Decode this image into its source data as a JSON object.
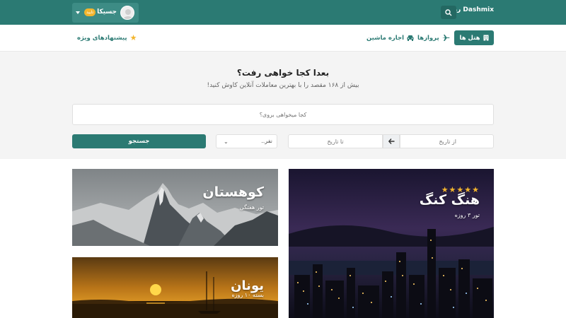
{
  "header": {
    "brand": "Dashmix رزرو",
    "user_name": "جسیکا",
    "user_badge": "تایید"
  },
  "nav": {
    "tabs": [
      {
        "label": "هتل ها",
        "icon": "building-icon",
        "active": true
      },
      {
        "label": "پروازها",
        "icon": "plane-icon",
        "active": false
      },
      {
        "label": "اجاره ماشین",
        "icon": "car-icon",
        "active": false
      }
    ],
    "offers": {
      "label": "پیشنهادهای ویژه",
      "icon": "star-icon"
    }
  },
  "hero": {
    "title": "بعدا کجا خواهی رفت؟",
    "subtitle": "بیش از ۱۶۸ مقصد را با بهترین معاملات آنلاین کاوش کنید!",
    "destination_placeholder": "کجا میخواهی بروی؟",
    "date_from_placeholder": "از تاریخ",
    "date_to_placeholder": "تا تاریخ",
    "people_value": "نفر..",
    "search_label": "جستجو"
  },
  "cards": [
    {
      "title": "هنگ کنگ",
      "subtitle": "تور ۳ روزه",
      "rating": 5,
      "stars": "★★★★★"
    },
    {
      "title": "کوهستان",
      "subtitle": "تور هفتگی"
    },
    {
      "title": "یونان",
      "subtitle": "بسته ۱۰ روزه"
    }
  ],
  "colors": {
    "primary": "#2b7a73",
    "badge": "#f3b52d",
    "star": "#f3b52d"
  }
}
